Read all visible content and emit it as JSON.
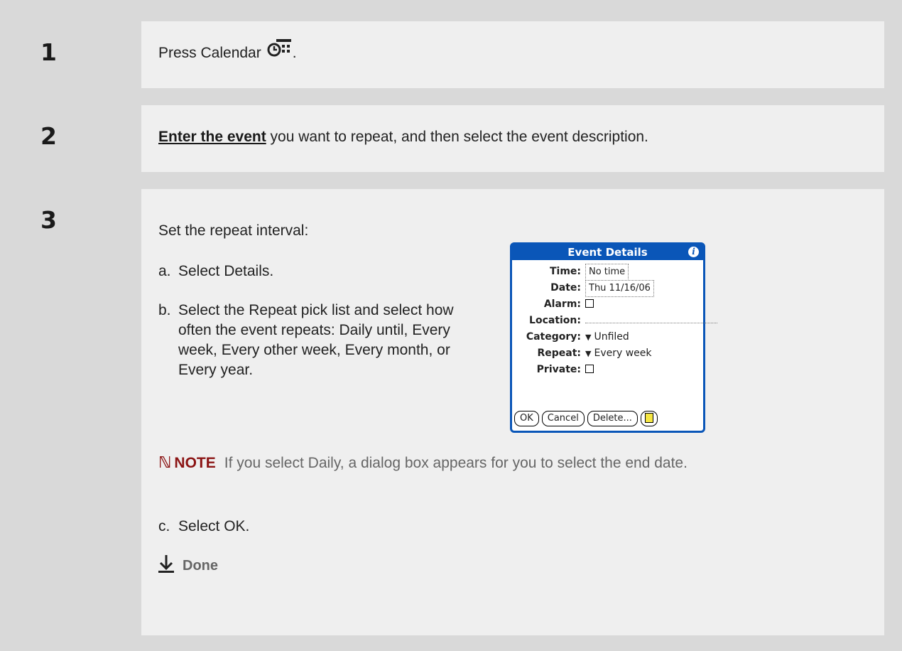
{
  "steps": [
    {
      "number": "1",
      "text_before": "Press Calendar",
      "text_after": "."
    },
    {
      "number": "2",
      "link_text": "Enter the event",
      "text": " you want to repeat, and then select the event description."
    },
    {
      "number": "3",
      "intro": "Set the repeat interval:",
      "substeps": [
        {
          "letter": "a.",
          "text": "Select Details."
        },
        {
          "letter": "b.",
          "text": "Select the Repeat pick list and select how often the event repeats: Daily until, Every week, Every other week, Every month, or Every year."
        },
        {
          "letter": "c.",
          "text": "Select OK."
        }
      ],
      "note": {
        "label": "NOTE",
        "text": "If you select Daily, a dialog box appears for you to select the end date."
      },
      "done_label": "Done"
    }
  ],
  "dialog": {
    "title": "Event Details",
    "time_label": "Time:",
    "time_value": "No time",
    "date_label": "Date:",
    "date_value": "Thu 11/16/06",
    "alarm_label": "Alarm:",
    "location_label": "Location:",
    "category_label": "Category:",
    "category_value": "Unfiled",
    "repeat_label": "Repeat:",
    "repeat_value": "Every week",
    "private_label": "Private:",
    "buttons": {
      "ok": "OK",
      "cancel": "Cancel",
      "delete": "Delete..."
    }
  },
  "colors": {
    "dialog_blue": "#0a56b8",
    "note_red": "#8b1414"
  }
}
